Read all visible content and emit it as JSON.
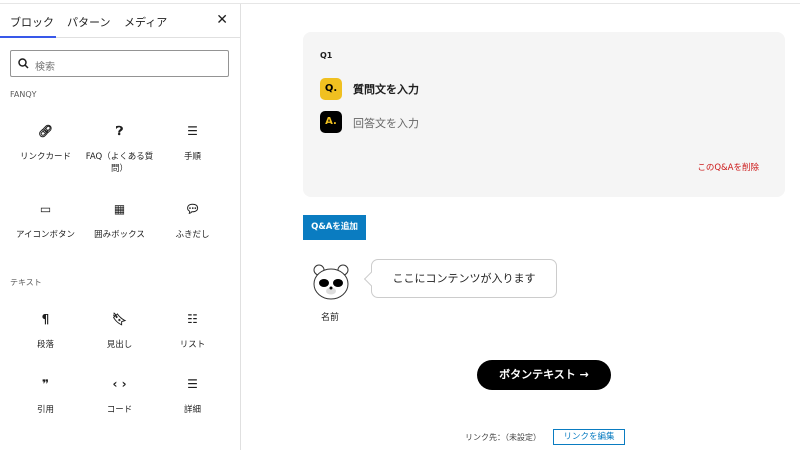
{
  "sidebar": {
    "tabs": [
      "ブロック",
      "パターン",
      "メディア"
    ],
    "search_placeholder": "検索",
    "categories": [
      {
        "label": "FANQY",
        "items": [
          {
            "label": "リンクカード",
            "icon": "link-icon"
          },
          {
            "label": "FAQ（よくある質問）",
            "icon": "help-icon"
          },
          {
            "label": "手順",
            "icon": "ordered-list-icon"
          },
          {
            "label": "アイコンボタン",
            "icon": "button-icon"
          },
          {
            "label": "囲みボックス",
            "icon": "table-icon"
          },
          {
            "label": "ふきだし",
            "icon": "speech-bubble-icon"
          }
        ]
      },
      {
        "label": "テキスト",
        "items": [
          {
            "label": "段落",
            "icon": "paragraph-icon"
          },
          {
            "label": "見出し",
            "icon": "bookmark-icon"
          },
          {
            "label": "リスト",
            "icon": "list-icon"
          },
          {
            "label": "引用",
            "icon": "quote-icon"
          },
          {
            "label": "コード",
            "icon": "code-icon"
          },
          {
            "label": "詳細",
            "icon": "details-icon"
          }
        ]
      }
    ]
  },
  "faq": {
    "number": "Q1",
    "q_badge": "Q.",
    "a_badge": "A.",
    "question_placeholder": "質問文を入力",
    "answer_placeholder": "回答文を入力",
    "delete_label": "このQ&Aを削除",
    "add_label": "Q&Aを追加",
    "q_color": "#f0c020",
    "a_color": "#000000"
  },
  "balloon": {
    "text": "ここにコンテンツが入ります",
    "name": "名前"
  },
  "button": {
    "label": "ボタンテキスト →",
    "link_label": "リンク先：（未設定）",
    "edit_label": "リンクを編集"
  },
  "colors": {
    "accent": "#0a7cc1",
    "delete": "#cc1818"
  }
}
